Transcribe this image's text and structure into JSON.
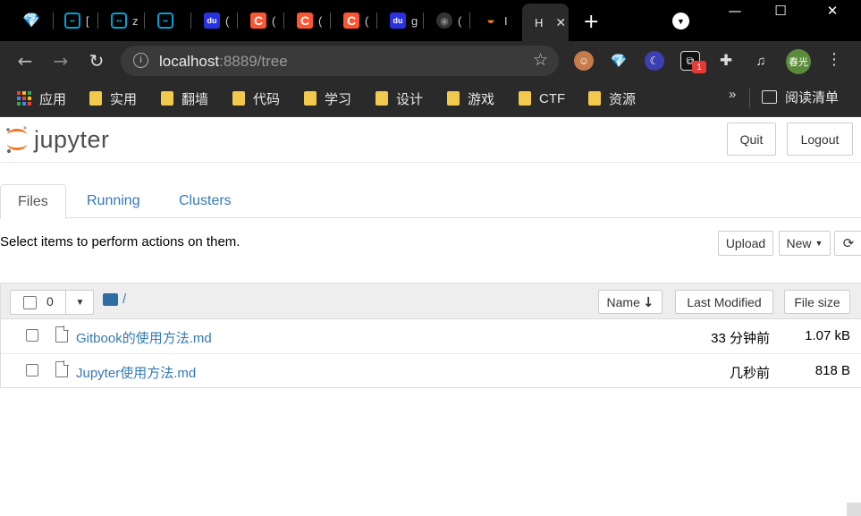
{
  "browser": {
    "tabs": [
      {
        "icon": "diamond-icon",
        "label": ""
      },
      {
        "icon": "bilibili-icon",
        "label": "["
      },
      {
        "icon": "bilibili-icon",
        "label": "z"
      },
      {
        "icon": "bilibili-icon",
        "label": ""
      },
      {
        "icon": "baidu-icon",
        "label": "("
      },
      {
        "icon": "csdn-icon",
        "label": "("
      },
      {
        "icon": "csdn-icon",
        "label": "("
      },
      {
        "icon": "csdn-icon",
        "label": "("
      },
      {
        "icon": "baidu-icon",
        "label": "g"
      },
      {
        "icon": "github-icon",
        "label": "("
      },
      {
        "icon": "jupyter-icon",
        "label": "I"
      },
      {
        "icon": "page-icon",
        "label": "H",
        "active": true
      }
    ],
    "new_tab": "+",
    "window_controls": {
      "minimize": "—",
      "maximize": "☐",
      "close": "✕"
    },
    "url": {
      "host": "localhost",
      "rest": ":8889/tree"
    },
    "profile_label": "春光",
    "extension_badge": "1",
    "bookmarks": [
      {
        "label": "应用",
        "icon": "apps-icon"
      },
      {
        "label": "实用",
        "icon": "folder-icon"
      },
      {
        "label": "翻墙",
        "icon": "folder-icon"
      },
      {
        "label": "代码",
        "icon": "folder-icon"
      },
      {
        "label": "学习",
        "icon": "folder-icon"
      },
      {
        "label": "设计",
        "icon": "folder-icon"
      },
      {
        "label": "游戏",
        "icon": "folder-icon"
      },
      {
        "label": "CTF",
        "icon": "folder-icon"
      },
      {
        "label": "资源",
        "icon": "folder-icon"
      }
    ],
    "bookmarks_more": "»",
    "reading_list": "阅读清单"
  },
  "jupyter": {
    "logo_text": "jupyter",
    "quit_label": "Quit",
    "logout_label": "Logout",
    "tabs": [
      "Files",
      "Running",
      "Clusters"
    ],
    "hint": "Select items to perform actions on them.",
    "upload_label": "Upload",
    "new_label": "New",
    "refresh_icon": "refresh-icon",
    "selected_count": "0",
    "breadcrumb": "/",
    "sort_name_label": "Name",
    "last_modified_label": "Last Modified",
    "file_size_label": "File size",
    "files": [
      {
        "name": "Gitbook的使用方法.md",
        "modified": "33 分钟前",
        "size": "1.07 kB"
      },
      {
        "name": "Jupyter使用方法.md",
        "modified": "几秒前",
        "size": "818 B"
      }
    ]
  },
  "colors": {
    "link": "#337ab7",
    "jupyter_orange": "#f37726",
    "csdn": "#fc5531",
    "baidu": "#2932e1",
    "bilibili": "#00a1d6"
  }
}
